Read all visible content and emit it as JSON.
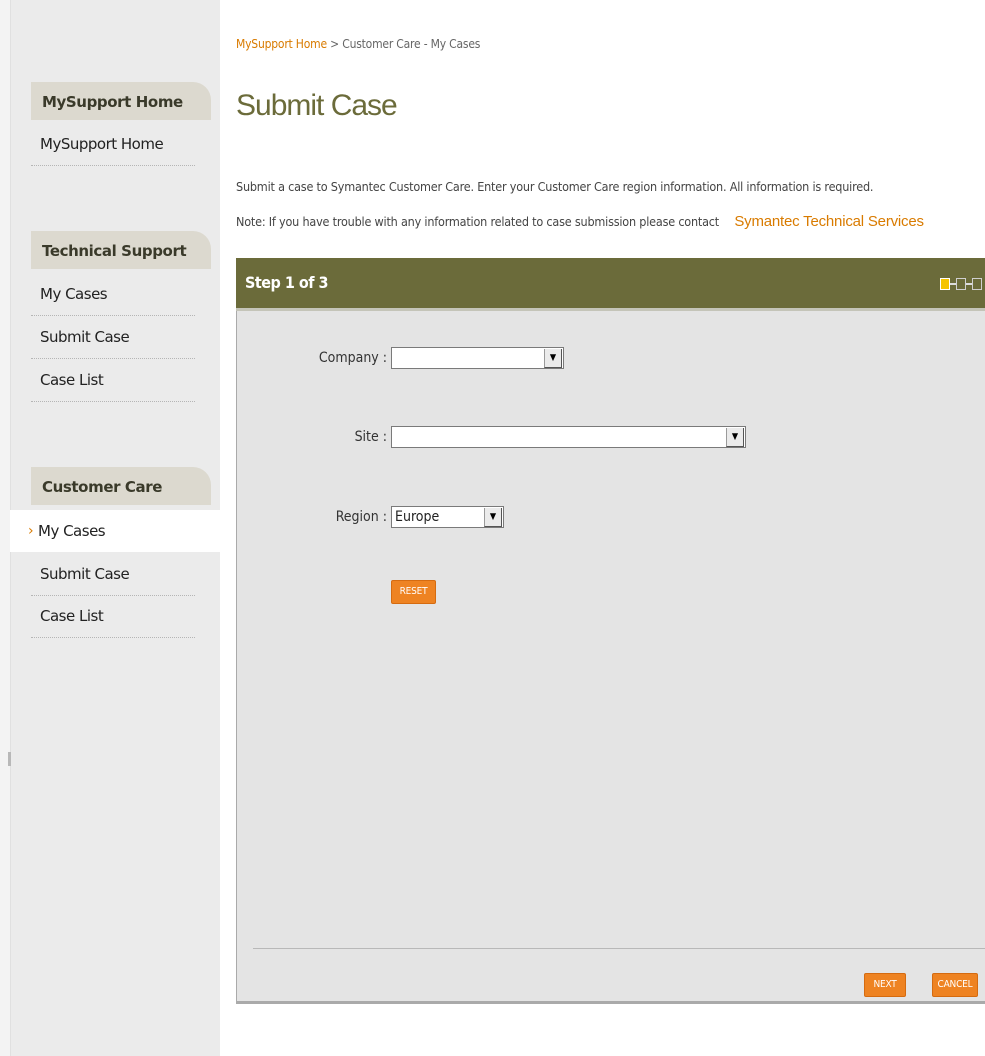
{
  "sidebar": {
    "sections": [
      {
        "title": "MySupport Home",
        "items": [
          {
            "label": "MySupport Home"
          }
        ]
      },
      {
        "title": "Technical Support",
        "items": [
          {
            "label": "My Cases"
          },
          {
            "label": "Submit Case"
          },
          {
            "label": "Case List"
          }
        ]
      },
      {
        "title": "Customer Care",
        "items": [
          {
            "label": "My Cases",
            "active": true,
            "marker": "›"
          },
          {
            "label": "Submit Case"
          },
          {
            "label": "Case List"
          }
        ]
      }
    ]
  },
  "breadcrumb": {
    "home": "MySupport Home",
    "separator": ">",
    "current": "Customer Care - My Cases"
  },
  "page": {
    "title": "Submit Case",
    "intro": "Submit a case to Symantec Customer Care. Enter your Customer Care region information. All information is required.",
    "note": "Note: If you have trouble with any information related to case submission please contact",
    "note_link": "Symantec Technical Services"
  },
  "step_panel": {
    "title": "Step 1 of 3",
    "current_step": 1,
    "total_steps": 3
  },
  "form": {
    "company": {
      "label": "Company :",
      "value": ""
    },
    "site": {
      "label": "Site :",
      "value": ""
    },
    "region": {
      "label": "Region :",
      "value": "Europe"
    },
    "reset_label": "RESET",
    "dropdown_glyph": "▼"
  },
  "actions": {
    "next_label": "NEXT",
    "cancel_label": "CANCEL"
  },
  "colors": {
    "accent_olive": "#6b6b3a",
    "accent_orange": "#ee8322",
    "link_orange": "#d97b00",
    "sidebar_bg": "#ebebeb",
    "panel_bg": "#e4e4e4"
  }
}
